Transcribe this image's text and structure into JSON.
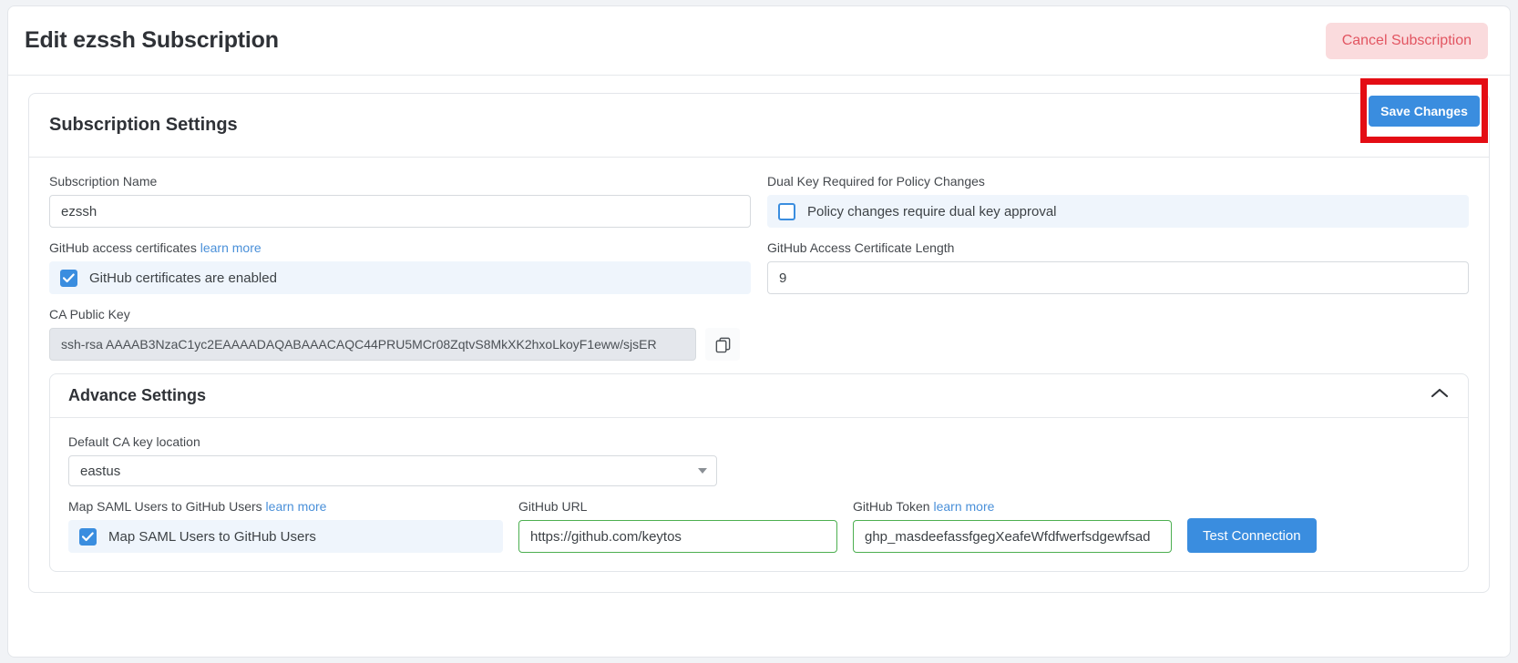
{
  "header": {
    "title": "Edit ezssh Subscription",
    "cancel_label": "Cancel Subscription"
  },
  "settings_section": {
    "title": "Subscription Settings",
    "save_label": "Save Changes"
  },
  "fields": {
    "subscription_name": {
      "label": "Subscription Name",
      "value": "ezssh",
      "placeholder": "Subscription Name"
    },
    "dual_key": {
      "label": "Dual Key Required for Policy Changes",
      "checkbox_label": "Policy changes require dual key approval",
      "checked": false
    },
    "github_access_certs": {
      "label": "GitHub access certificates",
      "learn_more": "learn more",
      "checkbox_label": "GitHub certificates are enabled",
      "checked": true
    },
    "cert_length": {
      "label": "GitHub Access Certificate Length",
      "value": "9",
      "placeholder": "Certificate Length"
    },
    "ca_public_key": {
      "label": "CA Public Key",
      "value": "ssh-rsa AAAAB3NzaC1yc2EAAAADAQABAAACAQC44PRU5MCr08ZqtvS8MkXK2hxoLkoyF1eww/sjsER",
      "copy_icon": "copy-icon"
    }
  },
  "advance_settings": {
    "title": "Advance Settings",
    "toggle_icon": "chevron-up-icon",
    "expanded": true,
    "ca_location": {
      "label": "Default CA key location",
      "value": "eastus",
      "options": [
        "eastus"
      ]
    },
    "map_saml": {
      "label": "Map SAML Users to GitHub Users",
      "learn_more": "learn more",
      "checkbox_label": "Map SAML Users to GitHub Users",
      "checked": true
    },
    "github_url": {
      "label": "GitHub URL",
      "value": "https://github.com/keytos",
      "placeholder": "GitHub URL"
    },
    "github_token": {
      "label": "GitHub Token",
      "learn_more": "learn more",
      "value": "ghp_masdeefassfgegXeafeWfdfwerfsdgewfsad",
      "placeholder": "GitHub Token"
    },
    "test_connection_label": "Test Connection"
  },
  "colors": {
    "accent_blue": "#3a8ddf",
    "danger_bg": "#fadbdd",
    "danger_text": "#e25561",
    "highlight_red": "#e40d14",
    "check_row_bg": "#eff5fc",
    "valid_green": "#4caf50"
  }
}
